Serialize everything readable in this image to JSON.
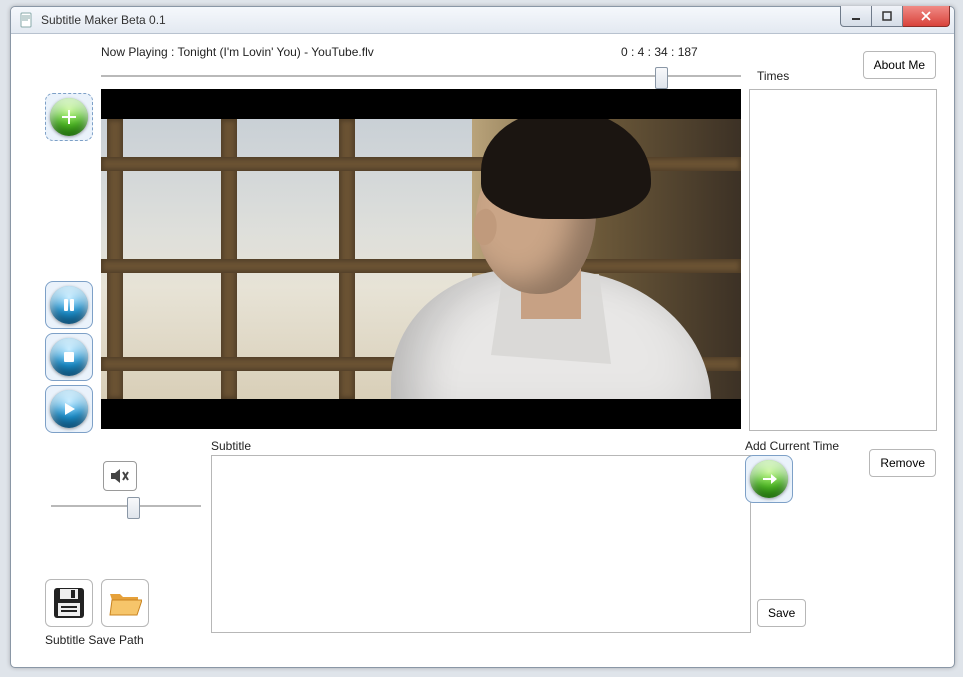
{
  "window": {
    "title": "Subtitle Maker Beta 0.1"
  },
  "header": {
    "now_playing_label": "Now Playing : Tonight (I'm Lovin' You) - YouTube.flv",
    "timecode": "0 : 4 : 34 : 187",
    "times_label": "Times",
    "about_label": "About Me",
    "seek_percent": 88
  },
  "subtitle": {
    "label": "Subtitle",
    "value": ""
  },
  "add_current_time": {
    "label": "Add Current Time"
  },
  "buttons": {
    "remove": "Remove",
    "save": "Save"
  },
  "volume": {
    "percent": 55
  },
  "path": {
    "label": "Subtitle Save Path"
  },
  "icons": {
    "add": "plus-icon",
    "pause": "pause-icon",
    "stop": "stop-icon",
    "play": "play-icon",
    "mute": "mute-icon",
    "arrow": "arrow-right-icon",
    "disk": "floppy-icon",
    "folder": "folder-open-icon"
  },
  "times_list": []
}
